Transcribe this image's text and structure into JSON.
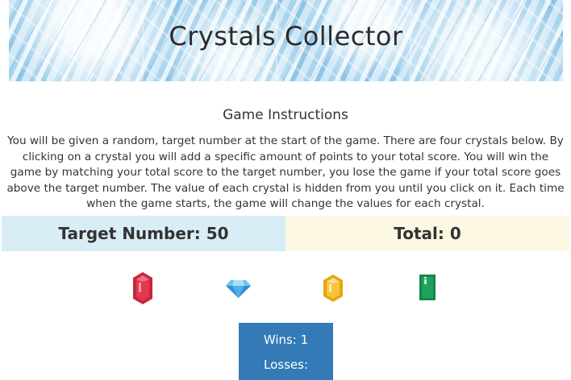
{
  "header": {
    "title": "Crystals Collector"
  },
  "instructions": {
    "title": "Game Instructions",
    "text": "You will be given a random, target number at the start of the game. There are four crystals below. By clicking on a crystal you will add a specific amount of points to your total score. You will win the game by matching your total score to the target number, you lose the game if your total score goes above the target number. The value of each crystal is hidden from you until you click on it. Each time when the game starts, the game will change the values for each crystal."
  },
  "target": {
    "label": "Target Number: 50"
  },
  "total": {
    "label": "Total: 0"
  },
  "crystals": [
    {
      "icon": "red-gem-icon",
      "color": "#e0384f"
    },
    {
      "icon": "blue-diamond-icon",
      "color": "#3fa9e6"
    },
    {
      "icon": "yellow-gem-icon",
      "color": "#f5b820"
    },
    {
      "icon": "green-gem-icon",
      "color": "#1fa35a"
    }
  ],
  "score": {
    "wins": "Wins: 1",
    "losses": "Losses:"
  },
  "colors": {
    "target_bg": "#d9edf7",
    "total_bg": "#fcf8e3",
    "score_bg": "#337ab7"
  }
}
